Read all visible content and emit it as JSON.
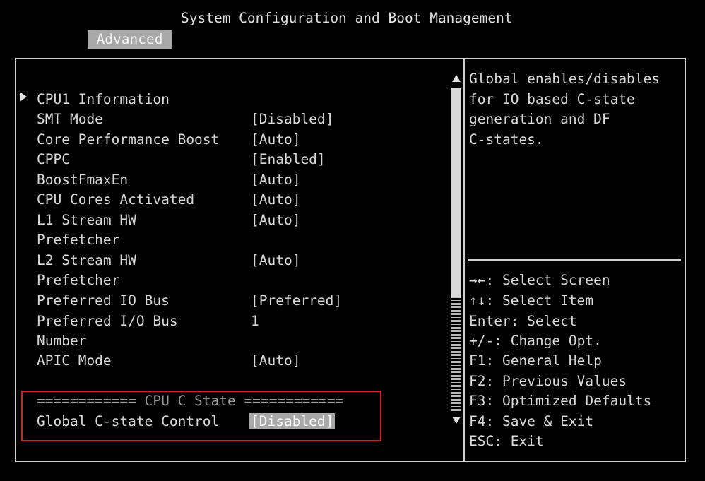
{
  "header": {
    "title": "System Configuration and Boot Management",
    "active_tab": "Advanced"
  },
  "settings": [
    {
      "label": "CPU1 Information",
      "value": "",
      "submenu": true
    },
    {
      "label": "SMT Mode",
      "value": "[Disabled]"
    },
    {
      "label": "Core Performance Boost",
      "value": "[Auto]"
    },
    {
      "label": "CPPC",
      "value": "[Enabled]"
    },
    {
      "label": "BoostFmaxEn",
      "value": "[Auto]"
    },
    {
      "label": "CPU Cores Activated",
      "value": "[Auto]"
    },
    {
      "label": "L1 Stream HW",
      "value": "[Auto]"
    },
    {
      "label": "Prefetcher",
      "value": ""
    },
    {
      "label": "L2 Stream HW",
      "value": "[Auto]"
    },
    {
      "label": "Prefetcher",
      "value": ""
    },
    {
      "label": "Preferred IO Bus",
      "value": "[Preferred]"
    },
    {
      "label": "Preferred I/O Bus",
      "value": "1"
    },
    {
      "label": "Number",
      "value": ""
    },
    {
      "label": "APIC Mode",
      "value": "[Auto]"
    }
  ],
  "c_state_section": {
    "header": "============ CPU C State ============",
    "label": "Global C-state Control",
    "value": "[Disabled]"
  },
  "help": {
    "lines": [
      "Global enables/disables",
      "for IO based C-state",
      "generation and DF",
      "C-states."
    ]
  },
  "keys": {
    "lines": [
      "→←: Select Screen",
      "↑↓: Select Item",
      "Enter: Select",
      "+/-: Change Opt.",
      "F1: General Help",
      "F2: Previous Values",
      "F3: Optimized Defaults",
      "F4: Save & Exit",
      "ESC: Exit"
    ]
  },
  "colors": {
    "background": "#000000",
    "text": "#d8d8d8",
    "selection": "#a8a8a8",
    "highlight_box": "#d0202a"
  }
}
